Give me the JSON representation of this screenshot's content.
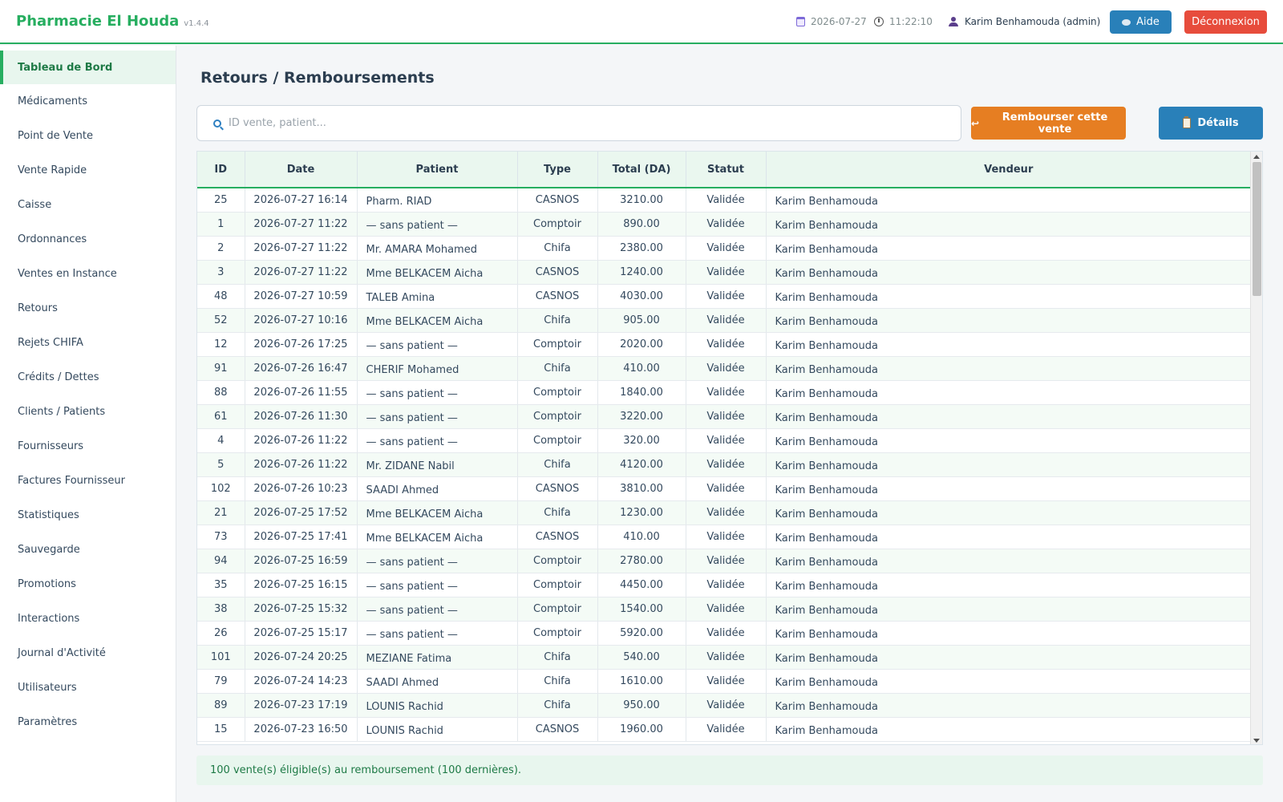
{
  "app": {
    "name": "Pharmacie El Houda",
    "version": "v1.4.4"
  },
  "header": {
    "date": "2026-07-27",
    "time": "11:22:10",
    "user": "Karim Benhamouda (admin)",
    "help_label": "Aide",
    "logout_label": "Déconnexion"
  },
  "sidebar": {
    "items": [
      {
        "label": "Tableau de Bord",
        "active": true
      },
      {
        "label": "Médicaments"
      },
      {
        "label": "Point de Vente"
      },
      {
        "label": "Vente Rapide"
      },
      {
        "label": "Caisse"
      },
      {
        "label": "Ordonnances"
      },
      {
        "label": "Ventes en Instance"
      },
      {
        "label": "Retours"
      },
      {
        "label": "Rejets CHIFA"
      },
      {
        "label": "Crédits / Dettes"
      },
      {
        "label": "Clients / Patients"
      },
      {
        "label": "Fournisseurs"
      },
      {
        "label": "Factures Fournisseur"
      },
      {
        "label": "Statistiques"
      },
      {
        "label": "Sauvegarde"
      },
      {
        "label": "Promotions"
      },
      {
        "label": "Interactions"
      },
      {
        "label": "Journal d'Activité"
      },
      {
        "label": "Utilisateurs"
      },
      {
        "label": "Paramètres"
      }
    ]
  },
  "main": {
    "title": "Retours / Remboursements",
    "search": {
      "placeholder": "ID vente, patient...",
      "value": ""
    },
    "refund_label": "Rembourser cette vente",
    "details_label": "Détails",
    "table": {
      "headers": [
        "ID",
        "Date",
        "Patient",
        "Type",
        "Total (DA)",
        "Statut",
        "Vendeur"
      ],
      "rows": [
        [
          "25",
          "2026-07-27 16:14",
          "Pharm. RIAD",
          "CASNOS",
          "3210.00",
          "Validée",
          "Karim Benhamouda"
        ],
        [
          "1",
          "2026-07-27 11:22",
          "— sans patient —",
          "Comptoir",
          "890.00",
          "Validée",
          "Karim Benhamouda"
        ],
        [
          "2",
          "2026-07-27 11:22",
          "Mr. AMARA Mohamed",
          "Chifa",
          "2380.00",
          "Validée",
          "Karim Benhamouda"
        ],
        [
          "3",
          "2026-07-27 11:22",
          "Mme BELKACEM Aicha",
          "CASNOS",
          "1240.00",
          "Validée",
          "Karim Benhamouda"
        ],
        [
          "48",
          "2026-07-27 10:59",
          "TALEB Amina",
          "CASNOS",
          "4030.00",
          "Validée",
          "Karim Benhamouda"
        ],
        [
          "52",
          "2026-07-27 10:16",
          "Mme BELKACEM Aicha",
          "Chifa",
          "905.00",
          "Validée",
          "Karim Benhamouda"
        ],
        [
          "12",
          "2026-07-26 17:25",
          "— sans patient —",
          "Comptoir",
          "2020.00",
          "Validée",
          "Karim Benhamouda"
        ],
        [
          "91",
          "2026-07-26 16:47",
          "CHERIF Mohamed",
          "Chifa",
          "410.00",
          "Validée",
          "Karim Benhamouda"
        ],
        [
          "88",
          "2026-07-26 11:55",
          "— sans patient —",
          "Comptoir",
          "1840.00",
          "Validée",
          "Karim Benhamouda"
        ],
        [
          "61",
          "2026-07-26 11:30",
          "— sans patient —",
          "Comptoir",
          "3220.00",
          "Validée",
          "Karim Benhamouda"
        ],
        [
          "4",
          "2026-07-26 11:22",
          "— sans patient —",
          "Comptoir",
          "320.00",
          "Validée",
          "Karim Benhamouda"
        ],
        [
          "5",
          "2026-07-26 11:22",
          "Mr. ZIDANE Nabil",
          "Chifa",
          "4120.00",
          "Validée",
          "Karim Benhamouda"
        ],
        [
          "102",
          "2026-07-26 10:23",
          "SAADI Ahmed",
          "CASNOS",
          "3810.00",
          "Validée",
          "Karim Benhamouda"
        ],
        [
          "21",
          "2026-07-25 17:52",
          "Mme BELKACEM Aicha",
          "Chifa",
          "1230.00",
          "Validée",
          "Karim Benhamouda"
        ],
        [
          "73",
          "2026-07-25 17:41",
          "Mme BELKACEM Aicha",
          "CASNOS",
          "410.00",
          "Validée",
          "Karim Benhamouda"
        ],
        [
          "94",
          "2026-07-25 16:59",
          "— sans patient —",
          "Comptoir",
          "2780.00",
          "Validée",
          "Karim Benhamouda"
        ],
        [
          "35",
          "2026-07-25 16:15",
          "— sans patient —",
          "Comptoir",
          "4450.00",
          "Validée",
          "Karim Benhamouda"
        ],
        [
          "38",
          "2026-07-25 15:32",
          "— sans patient —",
          "Comptoir",
          "1540.00",
          "Validée",
          "Karim Benhamouda"
        ],
        [
          "26",
          "2026-07-25 15:17",
          "— sans patient —",
          "Comptoir",
          "5920.00",
          "Validée",
          "Karim Benhamouda"
        ],
        [
          "101",
          "2026-07-24 20:25",
          "MEZIANE Fatima",
          "Chifa",
          "540.00",
          "Validée",
          "Karim Benhamouda"
        ],
        [
          "79",
          "2026-07-24 14:23",
          "SAADI Ahmed",
          "Chifa",
          "1610.00",
          "Validée",
          "Karim Benhamouda"
        ],
        [
          "89",
          "2026-07-23 17:19",
          "LOUNIS Rachid",
          "Chifa",
          "950.00",
          "Validée",
          "Karim Benhamouda"
        ],
        [
          "15",
          "2026-07-23 16:50",
          "LOUNIS Rachid",
          "CASNOS",
          "1960.00",
          "Validée",
          "Karim Benhamouda"
        ]
      ]
    },
    "footer_note": "100 vente(s) éligible(s) au remboursement (100 dernières)."
  },
  "colors": {
    "brand": "#27ae60",
    "primary": "#2980b9",
    "warning": "#e67e22",
    "danger": "#e74c3c"
  }
}
